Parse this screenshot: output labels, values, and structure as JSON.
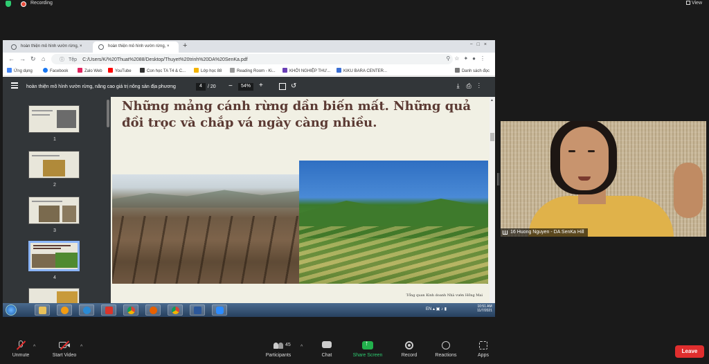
{
  "zoom_top": {
    "recording_label": "Recording",
    "view_label": "View"
  },
  "browser": {
    "tabs": [
      {
        "label": "hoàn thiện mô hình vườn rừng, ×"
      },
      {
        "label": "hoàn thiện mô hình vườn rừng, ×"
      }
    ],
    "new_tab": "+",
    "url_prefix": "Tệp",
    "url": "C:/Users/K/%20Thuat%2088/Desktop/Thuyet%20trinh%20DA%20SenKa.pdf",
    "bookmarks": [
      "Ứng dụng",
      "Facebook",
      "Zalo Web",
      "YouTube",
      "Con học TA T4 & C...",
      "Lớp học 88",
      "Reading Room - Ki...",
      "KHỞI NGHIỆP THƯ...",
      "KIKU BARA CENTER..."
    ],
    "bookmarks_right": "Danh sách đọc"
  },
  "pdf": {
    "title": "hoàn thiện mô hình vườn rừng, nâng cao giá trị nông sản địa phương",
    "page_current": "4",
    "page_total": "/ 20",
    "zoom": "54%",
    "thumb_numbers": [
      "1",
      "2",
      "3",
      "4"
    ],
    "slide_title": "Những mảng cánh rừng dần biến mất. Những quả đồi trọc và chắp vá ngày càng nhiều.",
    "slide_footer": "Tổng quan Kinh doanh Nhà vườn Hồng Mai"
  },
  "taskbar": {
    "tray_lang": "EN",
    "time": "10:51 AM",
    "date": "11/7/2021"
  },
  "video": {
    "participant_name": "16 Huong Nguyen - DA SenKa Hill"
  },
  "toolbar": {
    "unmute": "Unmute",
    "start_video": "Start Video",
    "participants": "Participants",
    "participants_count": "45",
    "chat": "Chat",
    "share_screen": "Share Screen",
    "record": "Record",
    "reactions": "Reactions",
    "apps": "Apps",
    "leave": "Leave"
  },
  "colors": {
    "leave": "#e02e2e",
    "share": "#22b14c",
    "pdf_toolbar": "#323639",
    "slide_title": "#5b3a33"
  }
}
